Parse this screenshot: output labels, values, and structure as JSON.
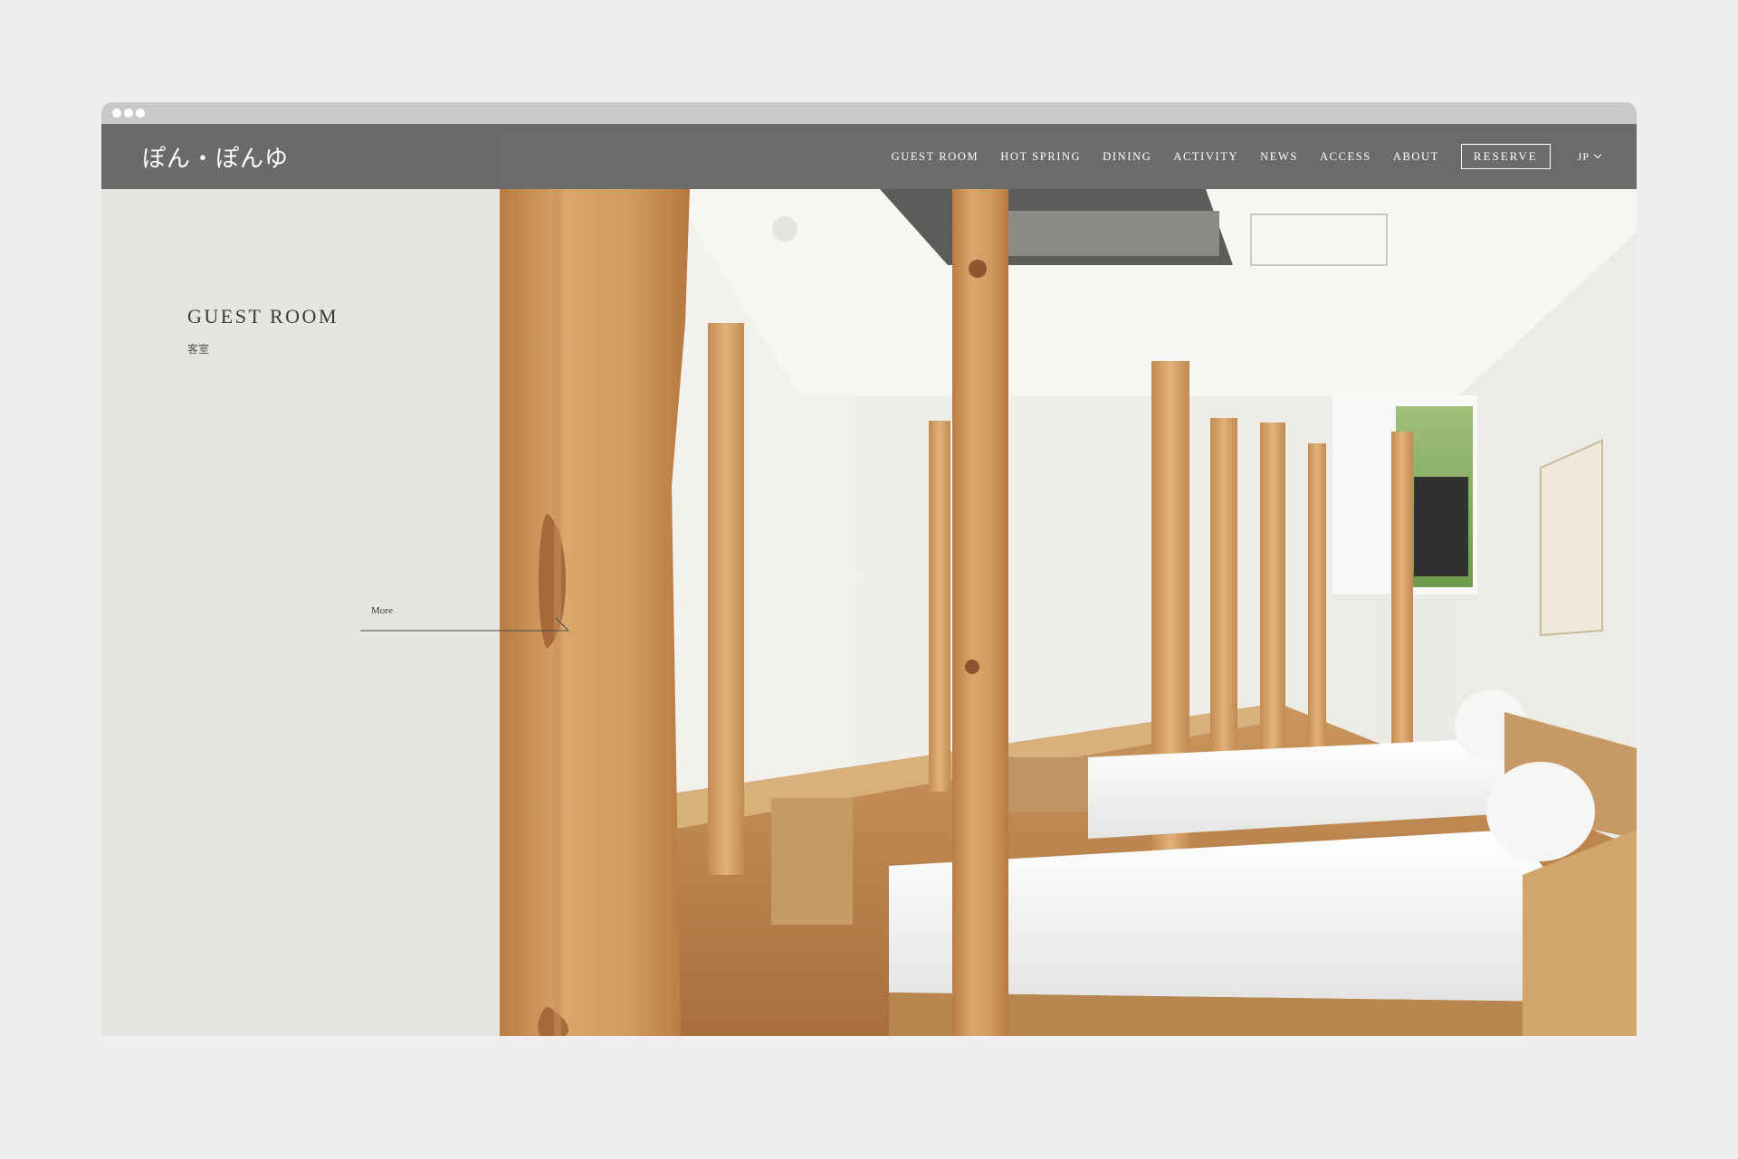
{
  "header": {
    "logo_text": "ぽん・ぽんゆ"
  },
  "nav": {
    "items": [
      "GUEST ROOM",
      "HOT SPRING",
      "DINING",
      "ACTIVITY",
      "NEWS",
      "ACCESS",
      "ABOUT"
    ],
    "reserve_label": "RESERVE",
    "language": "JP"
  },
  "hero": {
    "title": "GUEST ROOM",
    "subtitle": "客室",
    "more_label": "More"
  },
  "colors": {
    "page_background": "#efefef",
    "panel_background": "#e6e5e1",
    "header_background": "#60605e",
    "chrome_bar": "#c9c9c9",
    "text_dark": "#3a3a3a",
    "wood": "#d4a36a"
  }
}
